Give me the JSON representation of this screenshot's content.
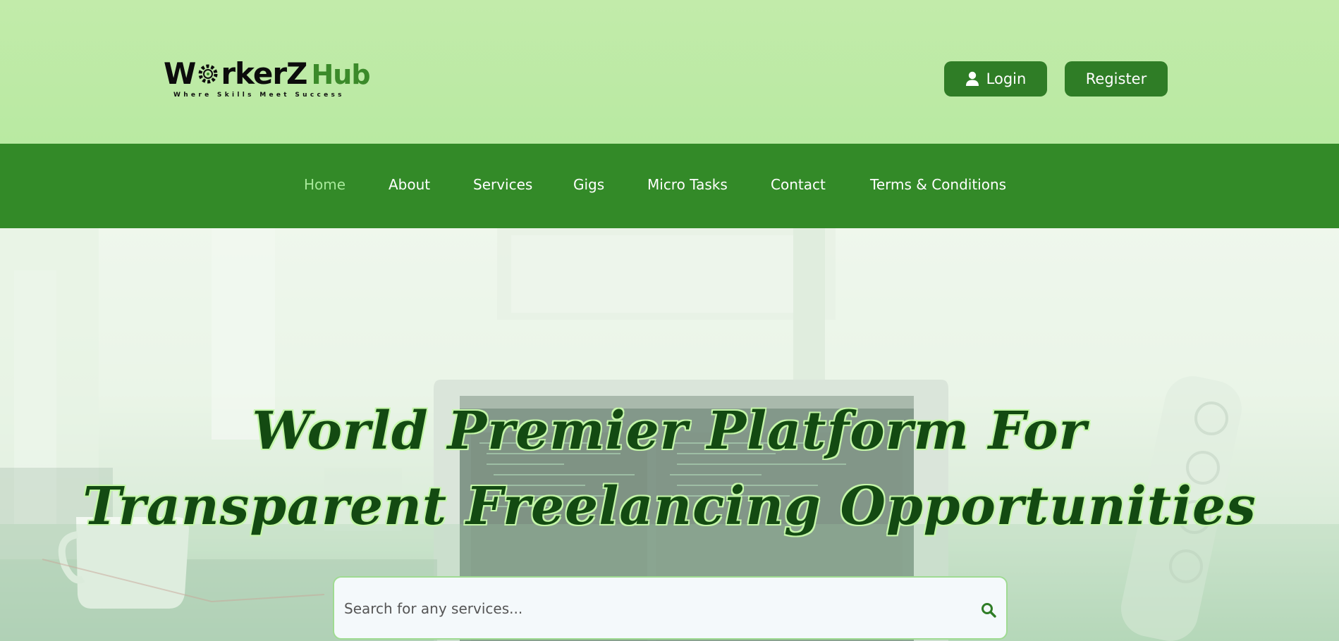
{
  "header": {
    "logo": {
      "text_main_prefix": "W",
      "text_main_suffix": "rkerZ",
      "text_hub": "Hub",
      "tagline": "Where Skills Meet Success"
    },
    "login_label": "Login",
    "register_label": "Register"
  },
  "nav": {
    "items": [
      {
        "label": "Home",
        "active": true
      },
      {
        "label": "About"
      },
      {
        "label": "Services"
      },
      {
        "label": "Gigs"
      },
      {
        "label": "Micro Tasks"
      },
      {
        "label": "Contact"
      },
      {
        "label": "Terms & Conditions"
      }
    ]
  },
  "hero": {
    "title_line1": "World Premier Platform For",
    "title_line2": "Transparent Freelancing Opportunities",
    "search": {
      "placeholder": "Search for any services..."
    }
  },
  "icons": {
    "user": "user-icon",
    "search": "search-icon",
    "gear": "gear-icon"
  },
  "colors": {
    "header_bg": "#c2ebaa",
    "nav_bg": "#338a28",
    "button_bg": "#2f7d26",
    "active_nav": "#a7e99a",
    "title_text": "#134a12"
  }
}
